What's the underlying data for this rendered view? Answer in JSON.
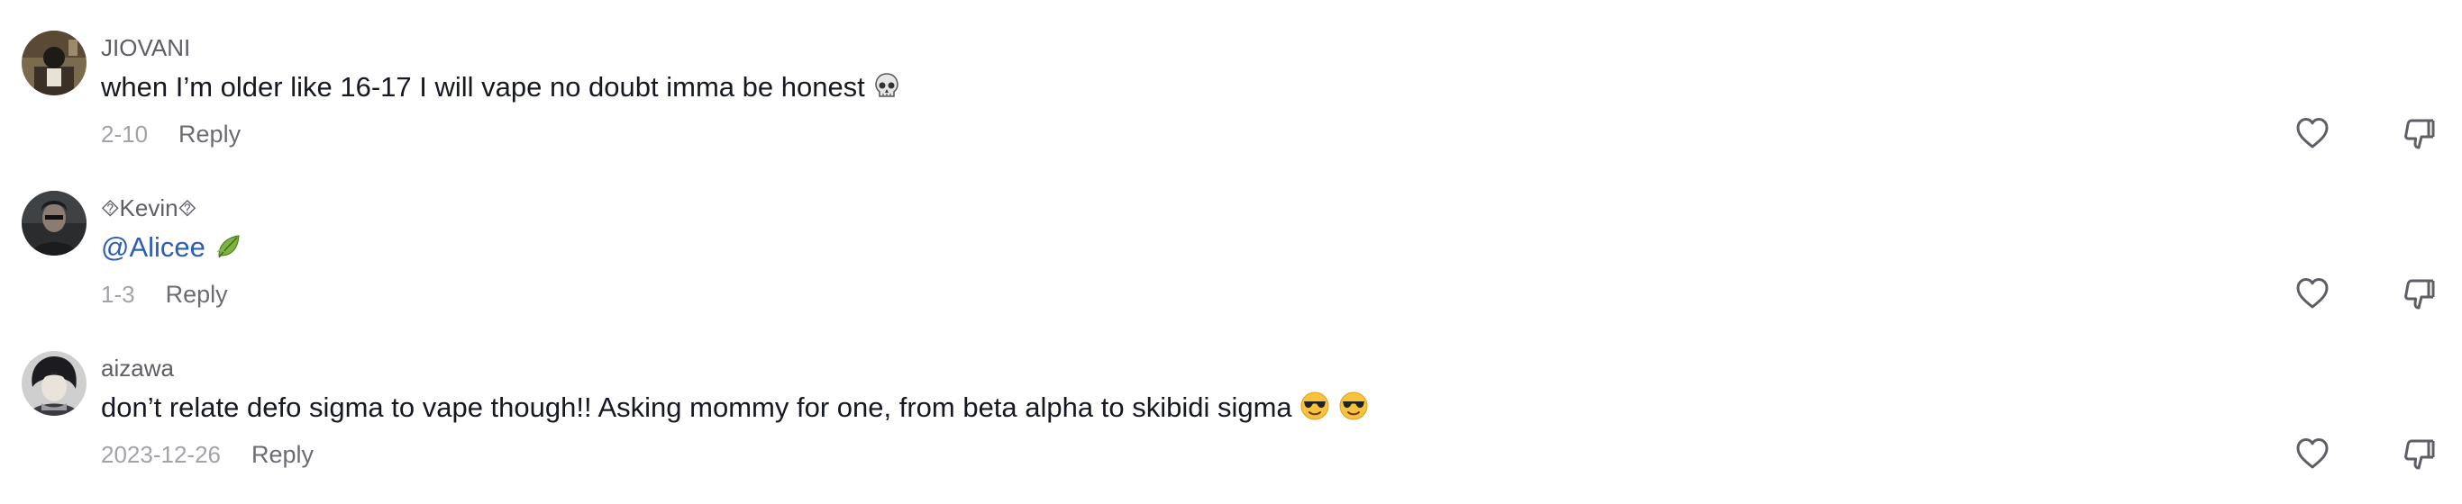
{
  "comments": [
    {
      "username": "JIOVANI",
      "text": "when I’m older like 16-17 I will vape no doubt imma be honest",
      "text_emoji": "skull-emoji",
      "date": "2-10",
      "reply_label": "Reply"
    },
    {
      "username": "⯑Kevin⯑",
      "mention": "@Alicee",
      "text_emoji": "leaf-emoji",
      "date": "1-3",
      "reply_label": "Reply"
    },
    {
      "username": "aizawa",
      "text": "don’t relate defo sigma to vape though!! Asking mommy for one, from beta alpha to skibidi sigma",
      "text_emoji": "smiling-face-with-sunglasses-emoji x2",
      "date": "2023-12-26",
      "reply_label": "Reply"
    }
  ],
  "icons": {
    "like": "heart-outline-icon",
    "dislike": "thumbs-down-outline-icon"
  },
  "colors": {
    "mention": "#2b5db9",
    "username": "#5e5e66",
    "date": "#a2a3a8",
    "reply": "#6b6c73",
    "text": "#161823"
  }
}
